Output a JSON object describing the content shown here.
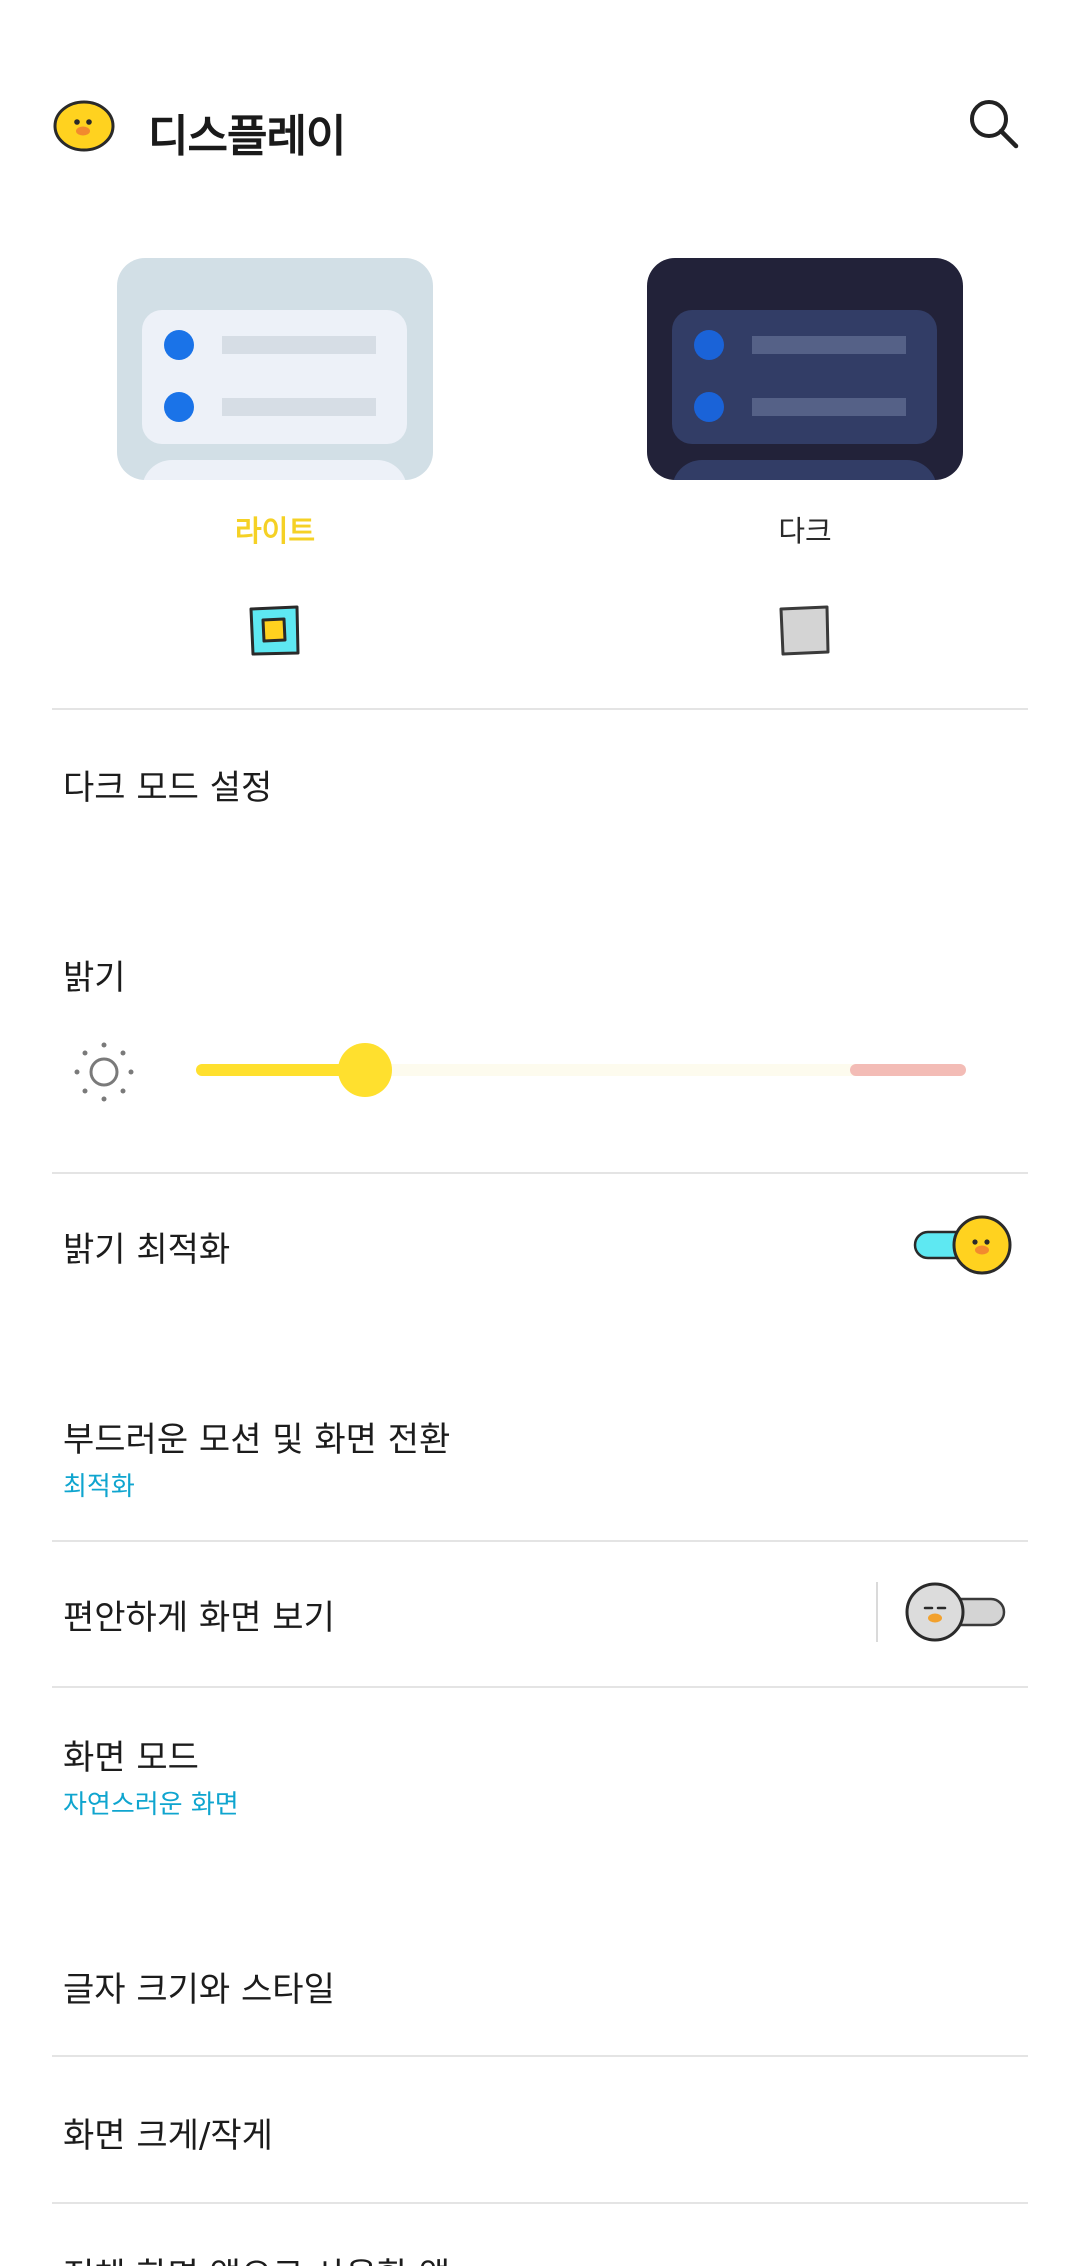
{
  "header": {
    "title": "디스플레이",
    "logo_icon": "duck-face-icon",
    "search_icon": "search-icon"
  },
  "theme": {
    "options": [
      {
        "label": "라이트",
        "selected": true
      },
      {
        "label": "다크",
        "selected": false
      }
    ]
  },
  "settings": {
    "dark_mode": {
      "title": "다크 모드 설정"
    },
    "brightness": {
      "title": "밝기",
      "level_percent": 22
    },
    "auto_brightness": {
      "title": "밝기 최적화",
      "enabled": true
    },
    "motion": {
      "title": "부드러운 모션 및 화면 전환",
      "value": "최적화"
    },
    "eye_comfort": {
      "title": "편안하게 화면 보기",
      "enabled": false
    },
    "screen_mode": {
      "title": "화면 모드",
      "value": "자연스러운 화면"
    },
    "font": {
      "title": "글자 크기와 스타일"
    },
    "zoom": {
      "title": "화면 크게/작게"
    },
    "partial": {
      "title": "전체 화면 앱으로 사용할 앱"
    }
  },
  "colors": {
    "accent": "#ffe02e",
    "accent_text": "#f5d125",
    "link": "#0fa5cf",
    "warn": "#f3bcb6",
    "toggle_on": "#5ee8f2"
  }
}
